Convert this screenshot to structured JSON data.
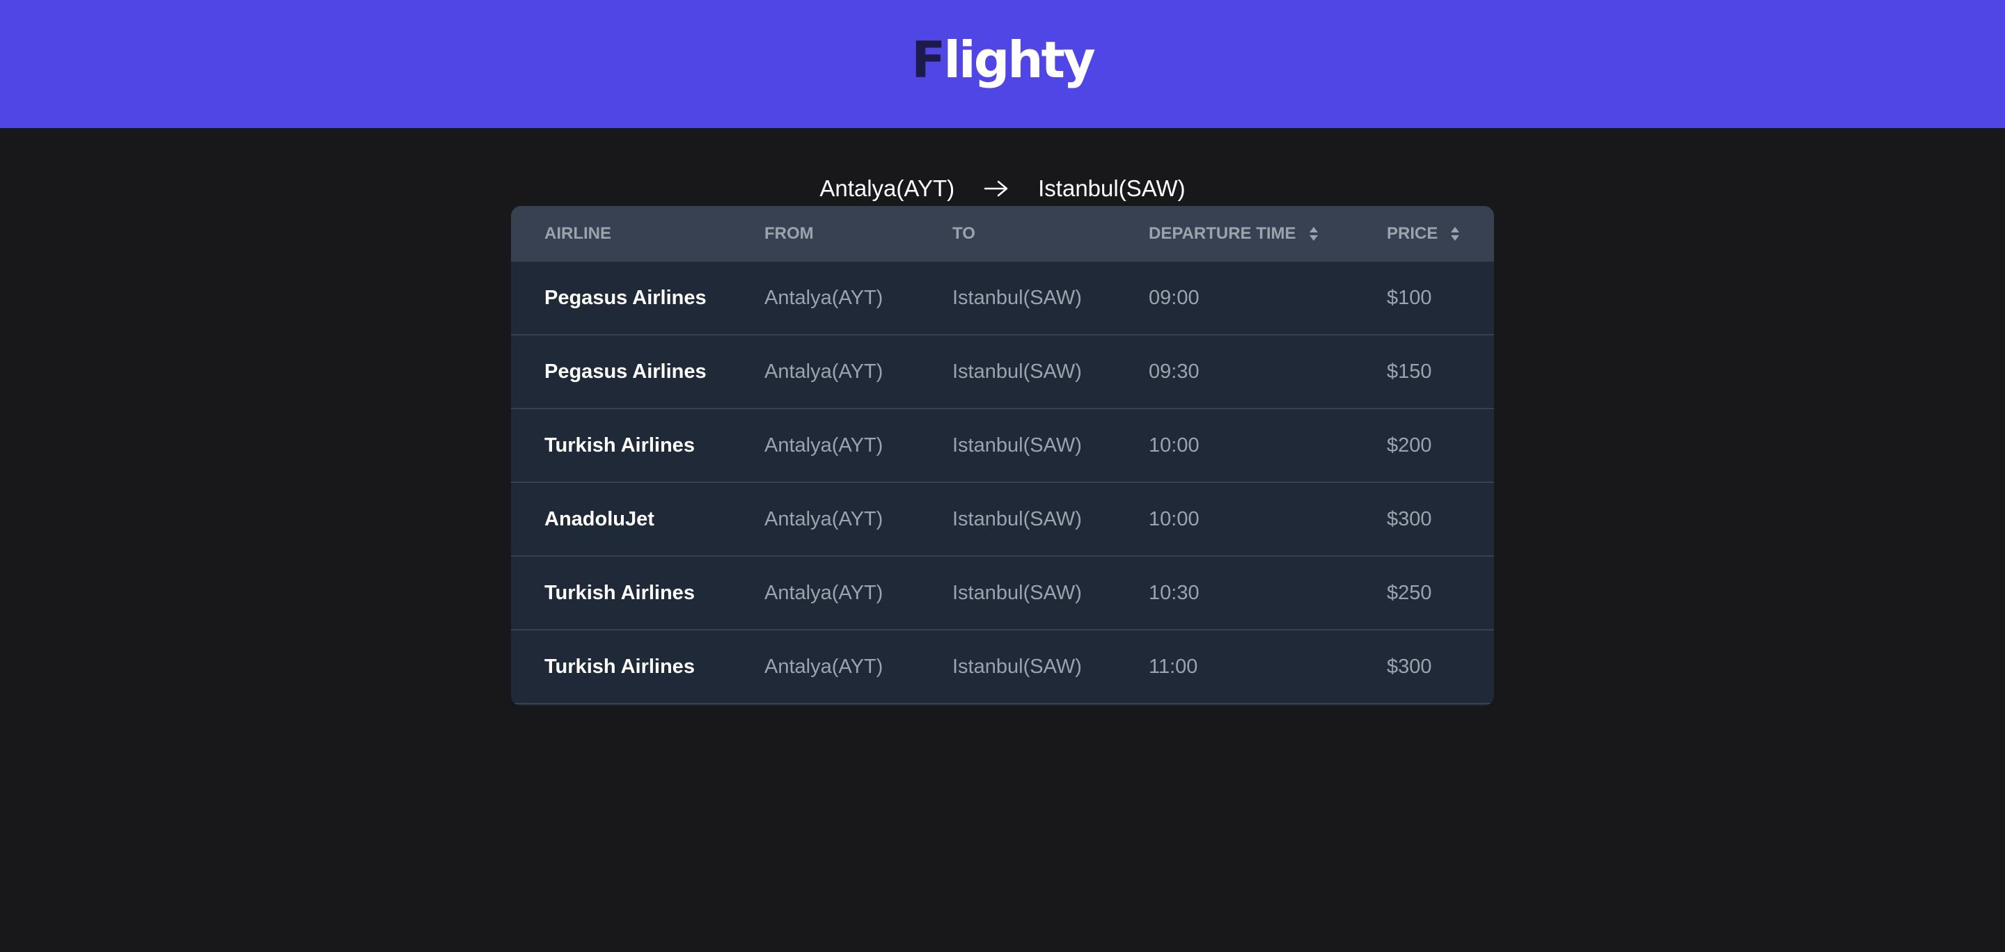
{
  "app": {
    "logo_first": "F",
    "logo_rest": "lighty"
  },
  "route": {
    "from": "Antalya(AYT)",
    "to": "Istanbul(SAW)",
    "arrow_icon": "arrow-right-icon"
  },
  "table": {
    "headers": {
      "airline": "AIRLINE",
      "from": "FROM",
      "to": "TO",
      "departure": "DEPARTURE TIME",
      "price": "PRICE"
    },
    "sort_icon": "sort-icon",
    "rows": [
      {
        "airline": "Pegasus Airlines",
        "from": "Antalya(AYT)",
        "to": "Istanbul(SAW)",
        "time": "09:00",
        "price": "$100"
      },
      {
        "airline": "Pegasus Airlines",
        "from": "Antalya(AYT)",
        "to": "Istanbul(SAW)",
        "time": "09:30",
        "price": "$150"
      },
      {
        "airline": "Turkish Airlines",
        "from": "Antalya(AYT)",
        "to": "Istanbul(SAW)",
        "time": "10:00",
        "price": "$200"
      },
      {
        "airline": "AnadoluJet",
        "from": "Antalya(AYT)",
        "to": "Istanbul(SAW)",
        "time": "10:00",
        "price": "$300"
      },
      {
        "airline": "Turkish Airlines",
        "from": "Antalya(AYT)",
        "to": "Istanbul(SAW)",
        "time": "10:30",
        "price": "$250"
      },
      {
        "airline": "Turkish Airlines",
        "from": "Antalya(AYT)",
        "to": "Istanbul(SAW)",
        "time": "11:00",
        "price": "$300"
      }
    ]
  },
  "colors": {
    "header_bg": "#4f46e5",
    "page_bg": "#18181b",
    "table_bg": "#1f2937",
    "table_head_bg": "#374151",
    "logo_accent": "#1e1b4b"
  }
}
